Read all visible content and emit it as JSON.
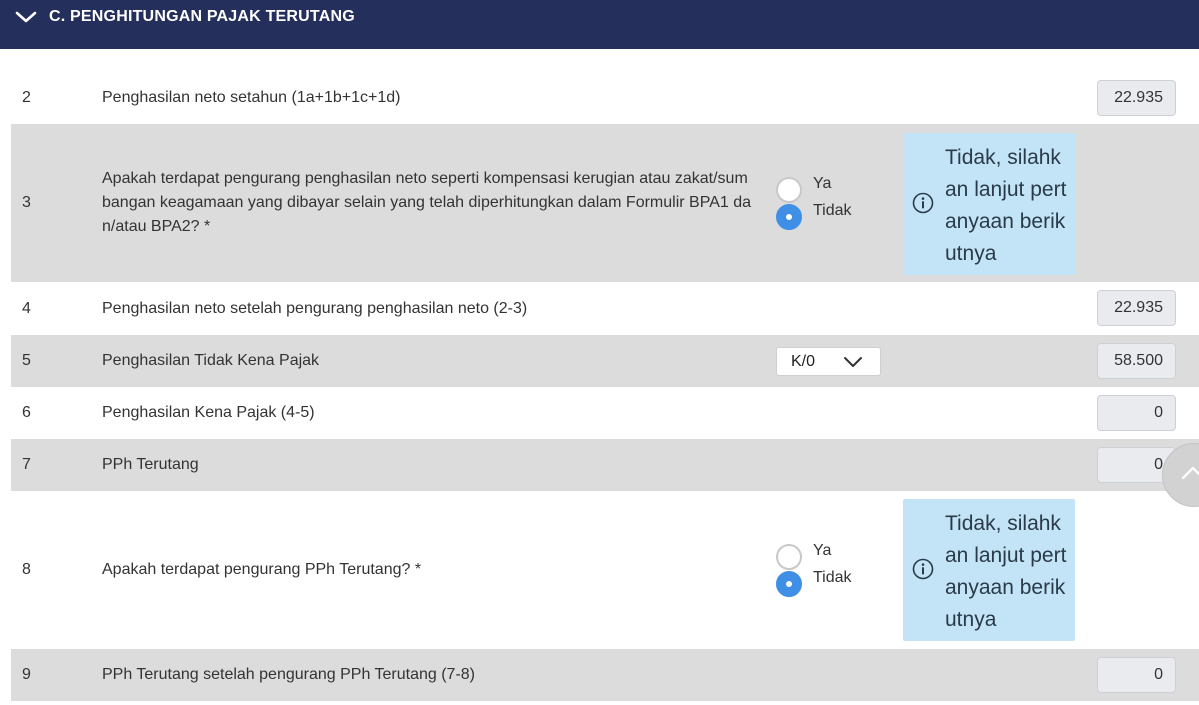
{
  "section": {
    "title": "C. PENGHITUNGAN PAJAK TERUTANG"
  },
  "rows": [
    {
      "num": "2",
      "label": "Penghasilan neto setahun (1a+1b+1c+1d)",
      "value": "22.935"
    },
    {
      "num": "3",
      "label": "Apakah terdapat pengurang penghasilan neto seperti kompensasi kerugian atau zakat/sumbangan keagamaan yang dibayar selain yang telah diperhitungkan dalam Formulir BPA1 dan/atau BPA2? *",
      "radio": {
        "yes": "Ya",
        "no": "Tidak",
        "selected": "Tidak"
      },
      "info": "Tidak, silahkan lanjut pertanyaan berikutnya"
    },
    {
      "num": "4",
      "label": "Penghasilan neto setelah pengurang penghasilan neto (2-3)",
      "value": "22.935"
    },
    {
      "num": "5",
      "label": "Penghasilan Tidak Kena Pajak",
      "select": "K/0",
      "value": "58.500"
    },
    {
      "num": "6",
      "label": "Penghasilan Kena Pajak (4-5)",
      "value": "0"
    },
    {
      "num": "7",
      "label": "PPh Terutang",
      "value": "0"
    },
    {
      "num": "8",
      "label": "Apakah terdapat pengurang PPh Terutang? *",
      "radio": {
        "yes": "Ya",
        "no": "Tidak",
        "selected": "Tidak"
      },
      "info": "Tidak, silahkan lanjut pertanyaan berikutnya"
    },
    {
      "num": "9",
      "label": "PPh Terutang setelah pengurang PPh Terutang (7-8)",
      "value": "0"
    }
  ],
  "colors": {
    "header_bg": "#242f5c",
    "row_shaded": "#dcdcdc",
    "radio_selected": "#3f8fe6",
    "info_bg": "#c3e4f7"
  }
}
